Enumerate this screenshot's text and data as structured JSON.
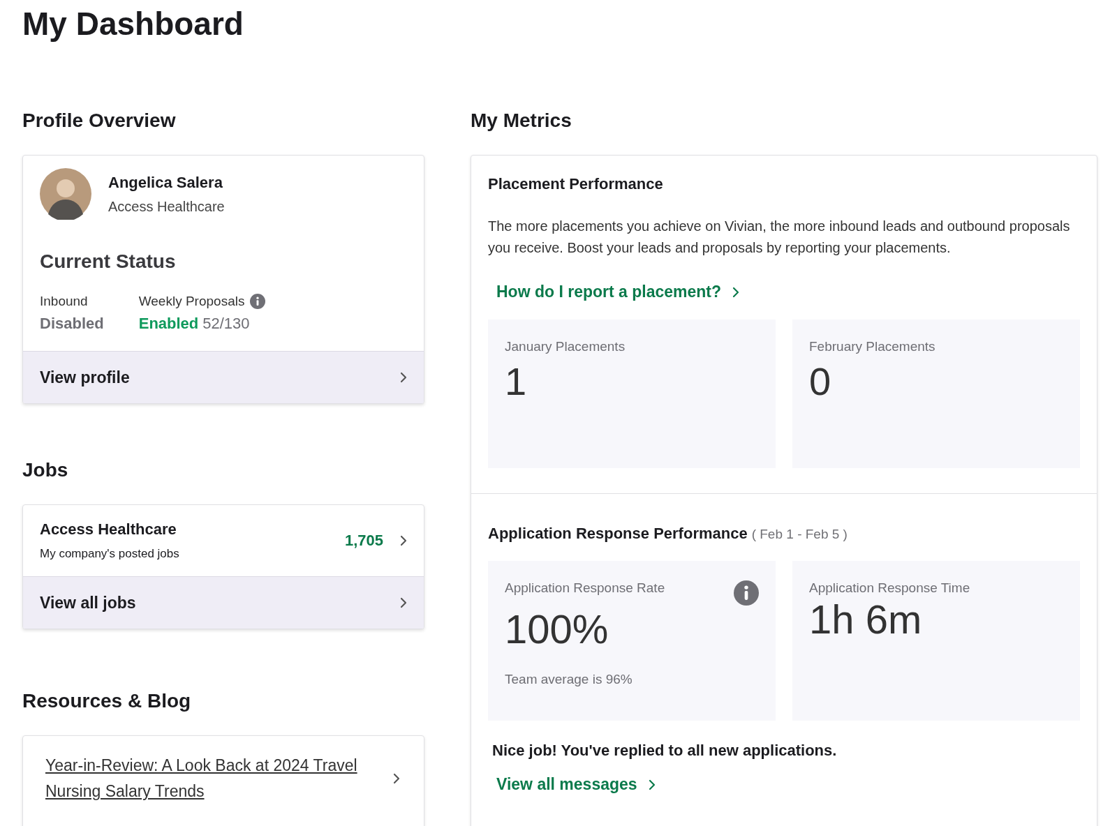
{
  "page": {
    "title": "My Dashboard"
  },
  "profile_overview": {
    "heading": "Profile Overview",
    "name": "Angelica Salera",
    "company": "Access Healthcare",
    "status_heading": "Current Status",
    "statuses": [
      {
        "label": "Inbound",
        "value": "Disabled",
        "enabled": false,
        "info": false
      },
      {
        "label": "Weekly Proposals",
        "value": "Enabled",
        "count": "52/130",
        "enabled": true,
        "info": true
      }
    ],
    "footer_link": "View profile"
  },
  "jobs": {
    "heading": "Jobs",
    "items": [
      {
        "title": "Access Healthcare",
        "subtitle": "My company's posted jobs",
        "count": "1,705"
      }
    ],
    "footer_link": "View all jobs"
  },
  "resources": {
    "heading": "Resources & Blog",
    "items": [
      {
        "title": "Year-in-Review: A Look Back at 2024 Travel Nursing Salary Trends"
      }
    ]
  },
  "metrics": {
    "heading": "My Metrics",
    "sections": [
      {
        "title": "Placement Performance",
        "description": "The more placements you achieve on Vivian, the more inbound leads and outbound proposals you receive. Boost your leads and proposals by reporting your placements.",
        "link": "How do I report a placement?",
        "tiles": [
          {
            "label": "January Placements",
            "value": "1",
            "info": false
          },
          {
            "label": "February Placements",
            "value": "0",
            "info": false
          }
        ]
      },
      {
        "title": "Application Response Performance",
        "date_range": "( Feb 1 - Feb 5 )",
        "tiles": [
          {
            "label": "Application Response Rate",
            "value": "100%",
            "note": "Team average is 96%",
            "info": true
          },
          {
            "label": "Application Response Time",
            "value": "1h 6m",
            "info": false
          }
        ],
        "message": "Nice job! You've replied to all new applications.",
        "link": "View all messages"
      }
    ]
  }
}
